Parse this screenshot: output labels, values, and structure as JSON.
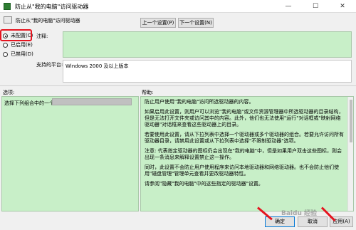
{
  "window": {
    "title": "防止从\"我的电脑\"访问驱动器",
    "controls": {
      "minimize": "—",
      "maximize": "☐",
      "close": "✕"
    }
  },
  "header": {
    "policy_name": "防止从\"我的电脑\"访问驱动器",
    "prev_button": "上一个设置(P)",
    "next_button": "下一个设置(N)"
  },
  "state": {
    "options": [
      {
        "label": "未配置(C)",
        "selected": true
      },
      {
        "label": "已启用(E)",
        "selected": false
      },
      {
        "label": "已禁用(D)",
        "selected": false
      }
    ]
  },
  "comment": {
    "label": "注释:",
    "value": ""
  },
  "platform": {
    "label": "支持的平台:",
    "value": "Windows 2000 及以上版本"
  },
  "options_panel": {
    "label": "选项:",
    "choose_label": "选择下列组合中的一个",
    "selected_value": ""
  },
  "help_panel": {
    "label": "帮助:",
    "paragraphs": [
      "防止用户使用\"我的电脑\"访问所选驱动器的内容。",
      "如果启用此设置，则用户可以浏览\"我的电脑\"或文件资源管理器中所选驱动器的目录结构，但是无法打开文件夹或访问其中的内容。此外，他们也无法使用\"运行\"对话框或\"映射网络驱动器\"对话框来查看这些驱动器上的目录。",
      "若要使用此设置，请从下拉列表中选择一个驱动器或多个驱动器的组合。若要允许访问所有驱动器目录，请禁用此设置或从下拉列表中选择\"不限制驱动器\"选项。",
      "注意: 代表指定驱动器的图标仍会出现在\"我的电脑\"中，但是如果用户双击这些图标，则会出现一条消息来解释设置禁止这一操作。",
      "同时，此设置不会防止用户使用程序来访问本地驱动器和网络驱动器。也不会防止他们使用\"磁盘管理\"管理单元查看并更改驱动器特性。",
      "请参阅\"隐藏\"我的电脑\"中的这些指定的驱动器\"设置。"
    ]
  },
  "footer": {
    "ok": "确定",
    "cancel": "取消",
    "apply": "应用(A)"
  },
  "watermark": "Baidu 经验",
  "colors": {
    "panel_green": "#c8efc8",
    "highlight_red": "#e5141f"
  }
}
